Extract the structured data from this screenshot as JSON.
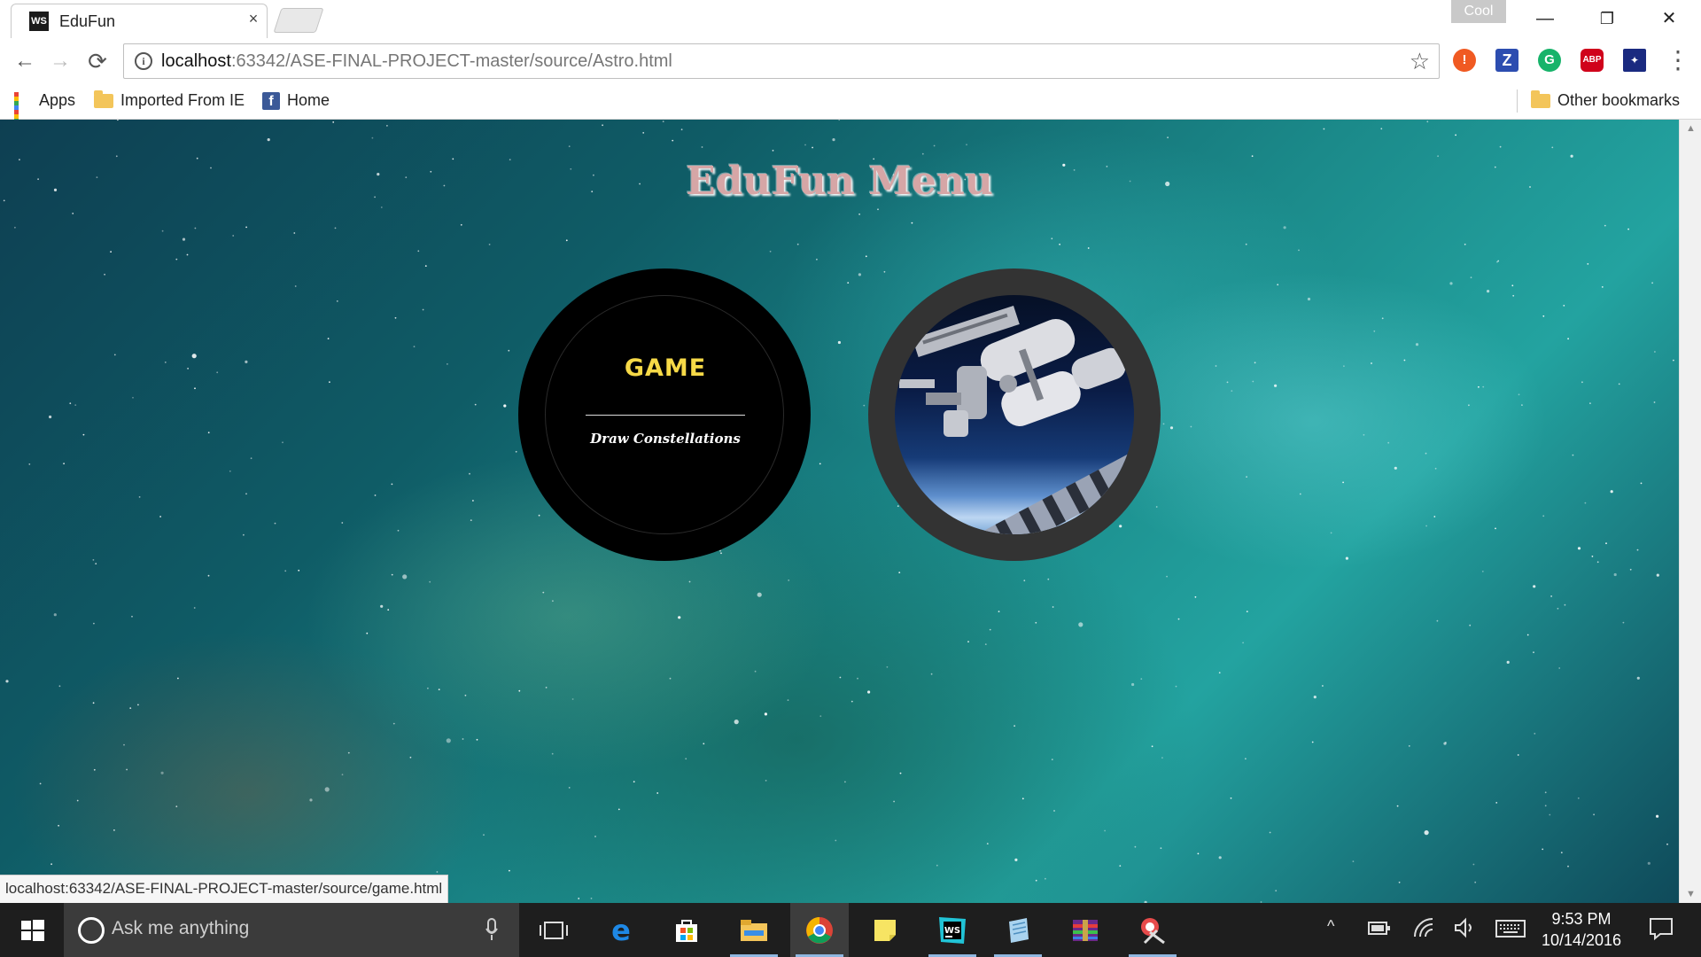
{
  "window": {
    "tab_favicon": "WS",
    "tab_title": "EduFun",
    "tab_close": "×",
    "profile_badge": "Cool",
    "minimize": "—",
    "restore": "❐",
    "close": "✕"
  },
  "toolbar": {
    "back": "←",
    "forward": "→",
    "reload": "⟳",
    "info": "i",
    "url_host": "localhost",
    "url_path": ":63342/ASE-FINAL-PROJECT-master/source/Astro.html",
    "star": "☆",
    "extensions": [
      {
        "name": "alert-extension-icon",
        "glyph": "!"
      },
      {
        "name": "z-extension-icon",
        "glyph": "Z"
      },
      {
        "name": "grammarly-extension-icon",
        "glyph": "G"
      },
      {
        "name": "adblock-extension-icon",
        "glyph": "ABP"
      },
      {
        "name": "flag-extension-icon",
        "glyph": "✦"
      }
    ],
    "menu": "⋮"
  },
  "bookmarks": {
    "apps": "Apps",
    "imported": "Imported From IE",
    "home": "Home",
    "facebook_glyph": "f",
    "other": "Other bookmarks"
  },
  "page": {
    "title": "EduFun Menu",
    "game_title": "GAME",
    "game_subtitle": "Draw Constellations"
  },
  "status_bar": {
    "url": "localhost:63342/ASE-FINAL-PROJECT-master/source/game.html"
  },
  "scrollbar": {
    "up": "▲",
    "down": "▼"
  },
  "taskbar": {
    "search_placeholder": "Ask me anything",
    "time": "9:53 PM",
    "date": "10/14/2016",
    "tray_chevron": "^"
  },
  "colors": {
    "title_color": "#d6a6a6",
    "game_title_color": "#f6d947",
    "taskbar": "#1e1e1e"
  }
}
